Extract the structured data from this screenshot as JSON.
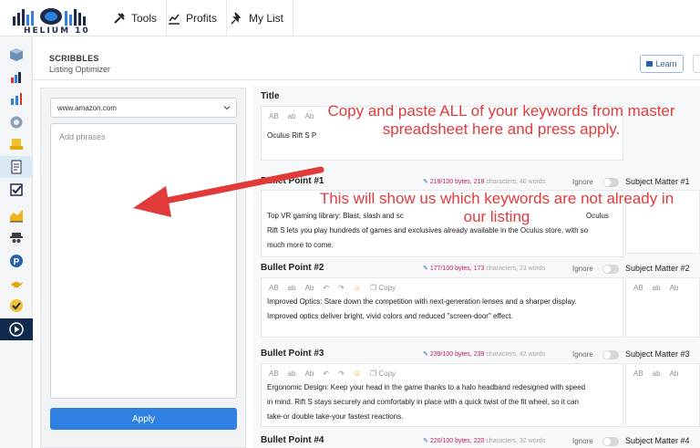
{
  "brand": {
    "name": "HELIUM 10"
  },
  "nav": {
    "tools": "Tools",
    "profits": "Profits",
    "mylist": "My List"
  },
  "header": {
    "title": "SCRIBBLES",
    "subtitle": "Listing Optimizer",
    "learn": "Learn"
  },
  "left": {
    "marketplace": "www.amazon.com",
    "phrases_placeholder": "Add phrases",
    "apply": "Apply"
  },
  "toolbar": {
    "upper": "AB",
    "lower": "ab",
    "title_case": "Ab",
    "copy": "Copy"
  },
  "title_section": {
    "label": "Title",
    "text": "Oculus Rift S P"
  },
  "bullets": [
    {
      "label": "Bullet Point #1",
      "bytes": "218/100 bytes, 218",
      "counts": "characters, 40 words",
      "ignore": "Ignore",
      "subject": "Subject Matter #1",
      "lines": [
        "Top VR gaming library: Blast, slash and sc",
        "Rift S lets you play hundreds of games and exclusives already available in the Oculus store, with so",
        "much more to come."
      ],
      "line1_tail": "Oculus"
    },
    {
      "label": "Bullet Point #2",
      "bytes": "177/100 bytes, 173",
      "counts": "characters, 23 words",
      "ignore": "Ignore",
      "subject": "Subject Matter #2",
      "lines": [
        "Improved Optics: Stare down the competition with next-generation lenses and a sharper display.",
        "Improved optics deliver bright, vivid colors and reduced \"screen-door\" effect."
      ]
    },
    {
      "label": "Bullet Point #3",
      "bytes": "239/100 bytes, 239",
      "counts": "characters, 42 words",
      "ignore": "Ignore",
      "subject": "Subject Matter #3",
      "lines": [
        "Ergonomic Design: Keep your head in the game thanks to a halo headband redesigned with speed",
        "in mind. Rift S stays securely and comfortably in place with a quick twist of the fit wheel, so it can",
        "take-or double take-your fastest reactions."
      ]
    },
    {
      "label": "Bullet Point #4",
      "bytes": "220/100 bytes, 220",
      "counts": "characters, 32 words",
      "ignore": "Ignore",
      "subject": "Subject Matter #4"
    }
  ],
  "annotations": {
    "top": "Copy and paste ALL of your keywords from master spreadsheet here and press apply.",
    "middle": "This will show us which keywords are not already in our listing"
  },
  "colors": {
    "accent": "#2f80e0",
    "annotation": "#e03a3a",
    "sidebar_dark": "#0f2a4a"
  }
}
